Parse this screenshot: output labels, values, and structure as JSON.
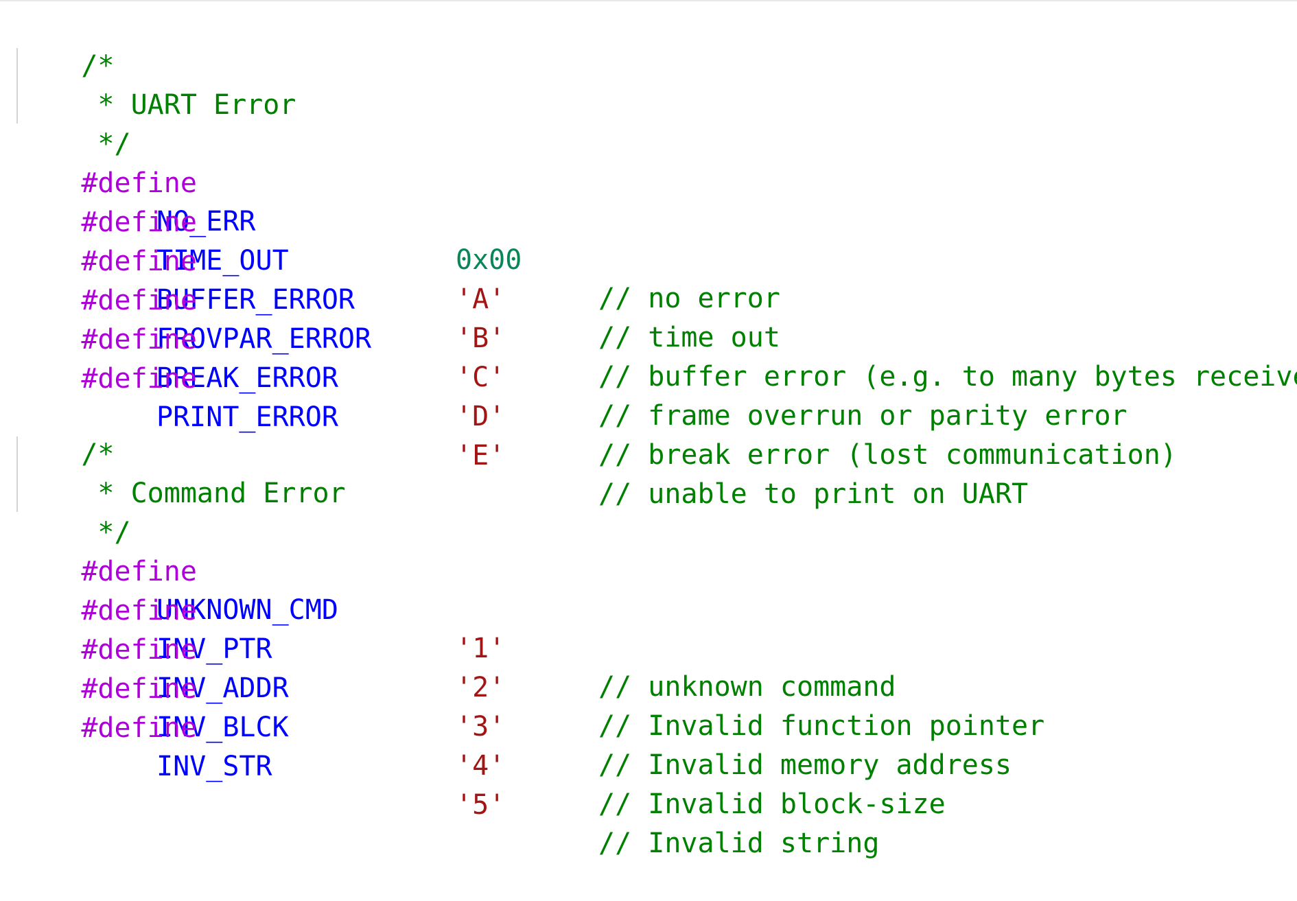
{
  "code": {
    "blocks": [
      {
        "comment_open": "/*",
        "comment_title": " * UART Error",
        "comment_close": " */",
        "defines": [
          {
            "keyword": "#define",
            "name": "NO_ERR",
            "value": "0x00",
            "value_type": "number",
            "comment": "// no error"
          },
          {
            "keyword": "#define",
            "name": "TIME_OUT",
            "value": "'A'",
            "value_type": "string",
            "comment": "// time out"
          },
          {
            "keyword": "#define",
            "name": "BUFFER_ERROR",
            "value": "'B'",
            "value_type": "string",
            "comment": "// buffer error (e.g. to many bytes received)"
          },
          {
            "keyword": "#define",
            "name": "FROVPAR_ERROR",
            "value": "'C'",
            "value_type": "string",
            "comment": "// frame overrun or parity error"
          },
          {
            "keyword": "#define",
            "name": "BREAK_ERROR",
            "value": "'D'",
            "value_type": "string",
            "comment": "// break error (lost communication)"
          },
          {
            "keyword": "#define",
            "name": "PRINT_ERROR",
            "value": "'E'",
            "value_type": "string",
            "comment": "// unable to print on UART"
          }
        ]
      },
      {
        "comment_open": "/*",
        "comment_title": " * Command Error",
        "comment_close": " */",
        "defines": [
          {
            "keyword": "#define",
            "name": "UNKNOWN_CMD",
            "value": "'1'",
            "value_type": "string",
            "comment": "// unknown command"
          },
          {
            "keyword": "#define",
            "name": "INV_PTR",
            "value": "'2'",
            "value_type": "string",
            "comment": "// Invalid function pointer"
          },
          {
            "keyword": "#define",
            "name": "INV_ADDR",
            "value": "'3'",
            "value_type": "string",
            "comment": "// Invalid memory address"
          },
          {
            "keyword": "#define",
            "name": "INV_BLCK",
            "value": "'4'",
            "value_type": "string",
            "comment": "// Invalid block-size"
          },
          {
            "keyword": "#define",
            "name": "INV_STR",
            "value": "'5'",
            "value_type": "string",
            "comment": "// Invalid string"
          }
        ]
      }
    ]
  },
  "colors": {
    "background": "#ffffff",
    "keyword": "#af00db",
    "macro_name": "#0000ff",
    "number": "#098658",
    "string": "#a31515",
    "comment": "#008000",
    "indent_guide": "#d4d4d4"
  }
}
